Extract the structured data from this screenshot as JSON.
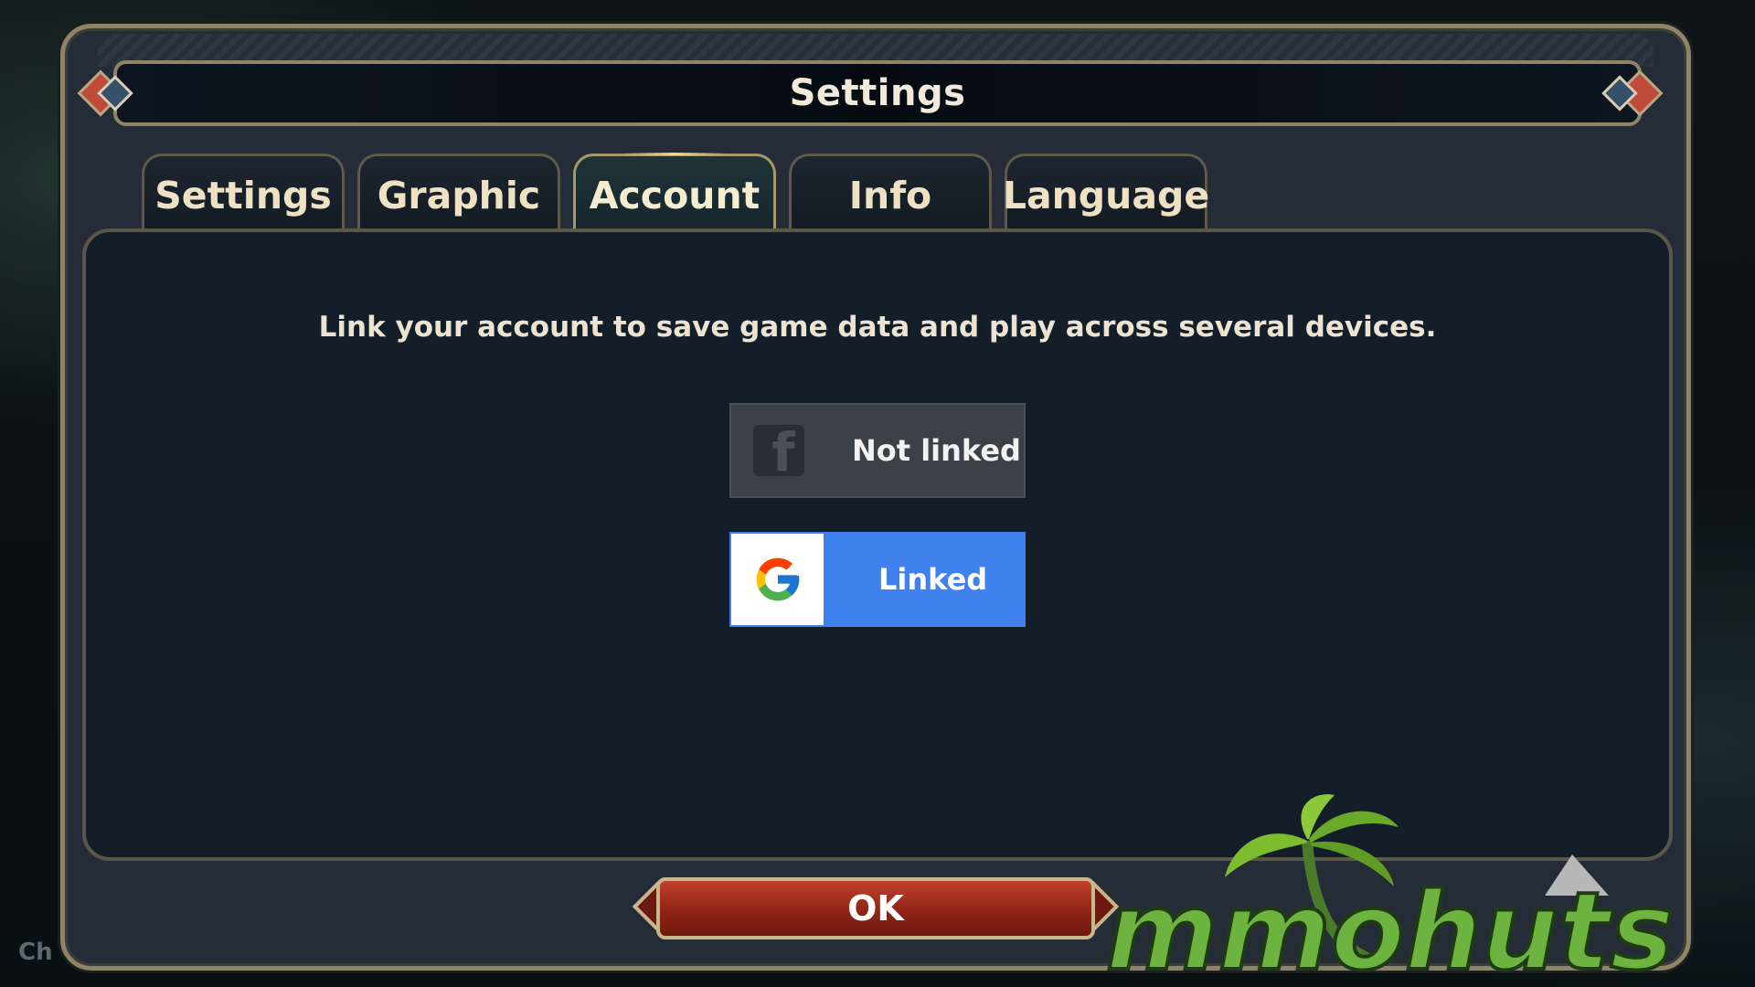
{
  "dialog": {
    "title": "Settings",
    "tabs": [
      {
        "label": "Settings",
        "active": false
      },
      {
        "label": "Graphic",
        "active": false
      },
      {
        "label": "Account",
        "active": true
      },
      {
        "label": "Info",
        "active": false
      },
      {
        "label": "Language",
        "active": false
      }
    ]
  },
  "account": {
    "description": "Link your account to save game data and play across several devices.",
    "facebook": {
      "icon": "facebook-icon",
      "status": "Not linked"
    },
    "google": {
      "icon": "google-icon",
      "status": "Linked"
    }
  },
  "ok_label": "OK",
  "background_text": "Ch",
  "watermark": "mmohuts",
  "colors": {
    "frame_gold": "#8f8464",
    "panel": "#141e28",
    "google_blue": "#3f82ed",
    "ok_red": "#8f2416"
  }
}
